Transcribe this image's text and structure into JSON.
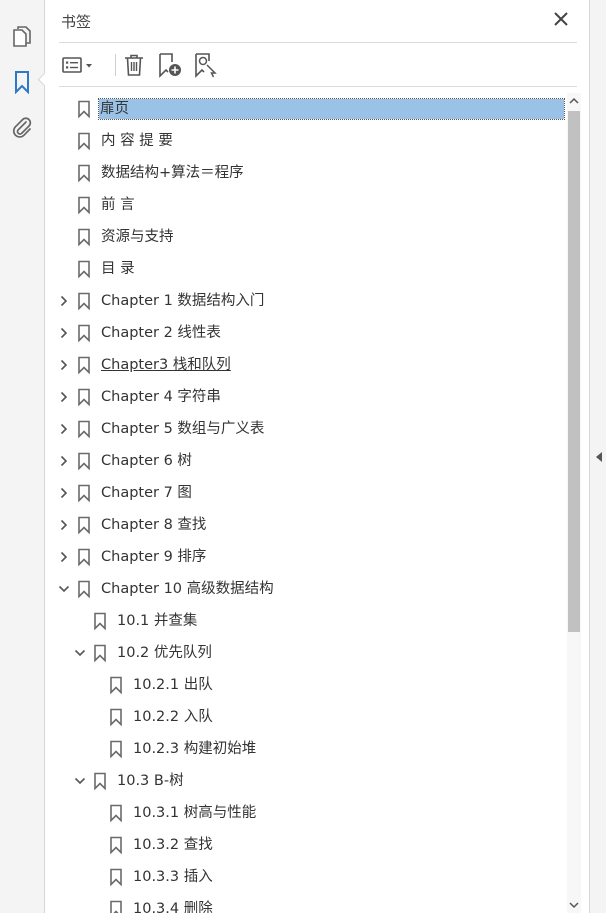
{
  "panel": {
    "title": "书签"
  },
  "bookmarks": [
    {
      "label": "扉页",
      "level": 0,
      "expander": "none",
      "selected": true
    },
    {
      "label": "内 容 提 要",
      "level": 0,
      "expander": "none"
    },
    {
      "label": "数据结构+算法＝程序",
      "level": 0,
      "expander": "none"
    },
    {
      "label": "前  言",
      "level": 0,
      "expander": "none"
    },
    {
      "label": "资源与支持",
      "level": 0,
      "expander": "none"
    },
    {
      "label": "目  录",
      "level": 0,
      "expander": "none"
    },
    {
      "label": "Chapter 1 数据结构入门",
      "level": 0,
      "expander": "collapsed"
    },
    {
      "label": "Chapter 2 线性表",
      "level": 0,
      "expander": "collapsed"
    },
    {
      "label": "Chapter3 栈和队列",
      "level": 0,
      "expander": "collapsed",
      "underline": true
    },
    {
      "label": "Chapter 4 字符串",
      "level": 0,
      "expander": "collapsed"
    },
    {
      "label": "Chapter 5 数组与广义表",
      "level": 0,
      "expander": "collapsed"
    },
    {
      "label": "Chapter 6 树",
      "level": 0,
      "expander": "collapsed"
    },
    {
      "label": "Chapter 7 图",
      "level": 0,
      "expander": "collapsed"
    },
    {
      "label": "Chapter 8 查找",
      "level": 0,
      "expander": "collapsed"
    },
    {
      "label": "Chapter 9 排序",
      "level": 0,
      "expander": "collapsed"
    },
    {
      "label": "Chapter 10 高级数据结构",
      "level": 0,
      "expander": "expanded"
    },
    {
      "label": "10.1 并查集",
      "level": 1,
      "expander": "none"
    },
    {
      "label": "10.2 优先队列",
      "level": 1,
      "expander": "expanded"
    },
    {
      "label": "10.2.1 出队",
      "level": 2,
      "expander": "none"
    },
    {
      "label": "10.2.2 入队",
      "level": 2,
      "expander": "none"
    },
    {
      "label": "10.2.3  构建初始堆",
      "level": 2,
      "expander": "none"
    },
    {
      "label": "10.3 B-树",
      "level": 1,
      "expander": "expanded"
    },
    {
      "label": "10.3.1  树高与性能",
      "level": 2,
      "expander": "none"
    },
    {
      "label": "10.3.2 查找",
      "level": 2,
      "expander": "none"
    },
    {
      "label": "10.3.3 插入",
      "level": 2,
      "expander": "none"
    },
    {
      "label": "10.3.4 删除",
      "level": 2,
      "expander": "none"
    }
  ],
  "colors": {
    "accent": "#2a7ac7",
    "selection": "#99c2e6",
    "icon": "#6b6b6b"
  }
}
